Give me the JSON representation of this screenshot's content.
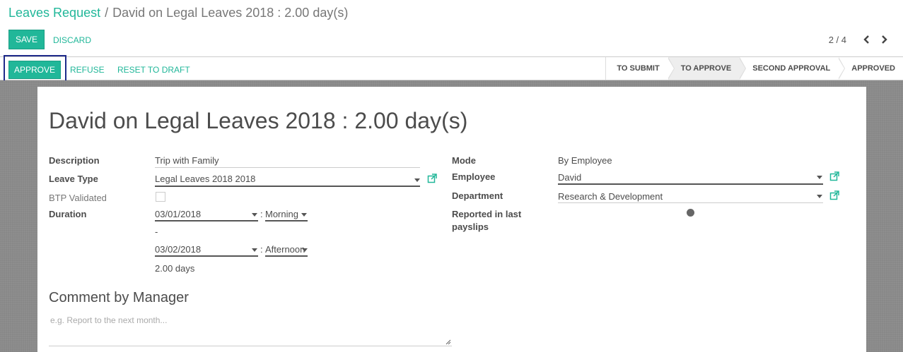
{
  "breadcrumb": {
    "parent": "Leaves Request",
    "separator": "/",
    "current": "David on Legal Leaves 2018 : 2.00 day(s)"
  },
  "toolbar": {
    "save_label": "SAVE",
    "discard_label": "DISCARD"
  },
  "pager": {
    "value": "2 / 4",
    "prev_icon": "chevron-left-icon",
    "next_icon": "chevron-right-icon"
  },
  "statusbar": {
    "approve_label": "APPROVE",
    "refuse_label": "REFUSE",
    "reset_label": "RESET TO DRAFT",
    "stages": [
      {
        "label": "TO SUBMIT",
        "active": false
      },
      {
        "label": "TO APPROVE",
        "active": true
      },
      {
        "label": "SECOND APPROVAL",
        "active": false
      },
      {
        "label": "APPROVED",
        "active": false
      }
    ]
  },
  "form": {
    "title": "David on Legal Leaves 2018 : 2.00 day(s)",
    "left": {
      "description_label": "Description",
      "description_value": "Trip with Family",
      "leave_type_label": "Leave Type",
      "leave_type_value": "Legal Leaves 2018 2018",
      "btp_label": "BTP Validated",
      "btp_checked": false,
      "duration_label": "Duration",
      "date_from": "03/01/2018",
      "period_from": "Morning",
      "dash": "-",
      "date_to": "03/02/2018",
      "period_to": "Afternoon",
      "colon": ":",
      "days_value": "2.00 days"
    },
    "right": {
      "mode_label": "Mode",
      "mode_value": "By Employee",
      "employee_label": "Employee",
      "employee_value": "David",
      "department_label": "Department",
      "department_value": "Research & Development",
      "reported_label_line1": "Reported in last",
      "reported_label_line2": "payslips"
    },
    "comment_section_title": "Comment by Manager",
    "comment_placeholder": "e.g. Report to the next month..."
  },
  "colors": {
    "accent": "#21b799",
    "highlight_border": "#1f2a8a",
    "background_gray": "#888888"
  }
}
